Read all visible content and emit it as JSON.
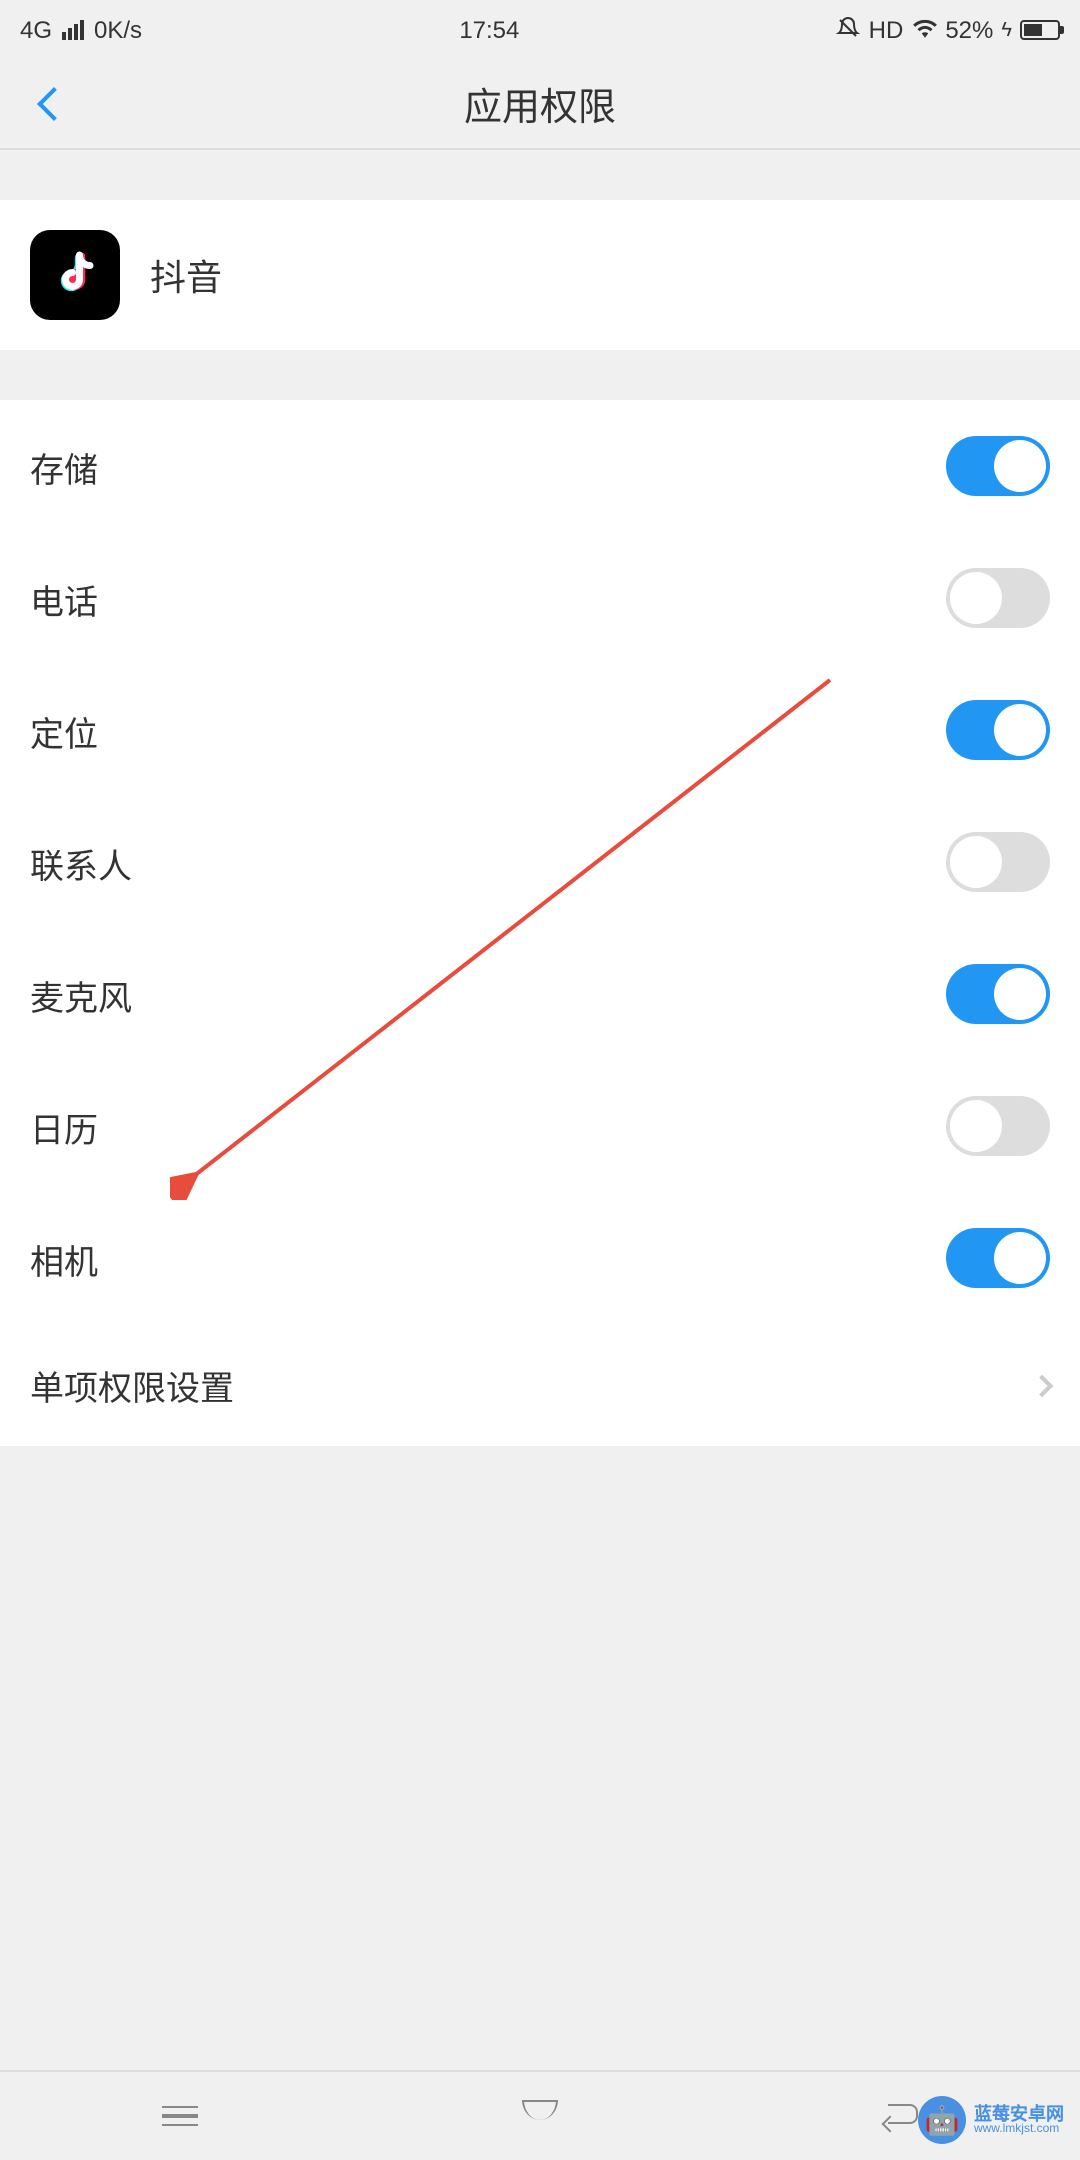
{
  "status_bar": {
    "network_type": "4G",
    "speed": "0K/s",
    "time": "17:54",
    "hd": "HD",
    "battery_percent": "52%"
  },
  "header": {
    "title": "应用权限"
  },
  "app": {
    "name": "抖音"
  },
  "permissions": [
    {
      "label": "存储",
      "enabled": true
    },
    {
      "label": "电话",
      "enabled": false
    },
    {
      "label": "定位",
      "enabled": true
    },
    {
      "label": "联系人",
      "enabled": false
    },
    {
      "label": "麦克风",
      "enabled": true
    },
    {
      "label": "日历",
      "enabled": false
    },
    {
      "label": "相机",
      "enabled": true
    }
  ],
  "link_item": {
    "label": "单项权限设置"
  },
  "watermark": {
    "name": "蓝莓安卓网",
    "url": "www.lmkjst.com"
  }
}
